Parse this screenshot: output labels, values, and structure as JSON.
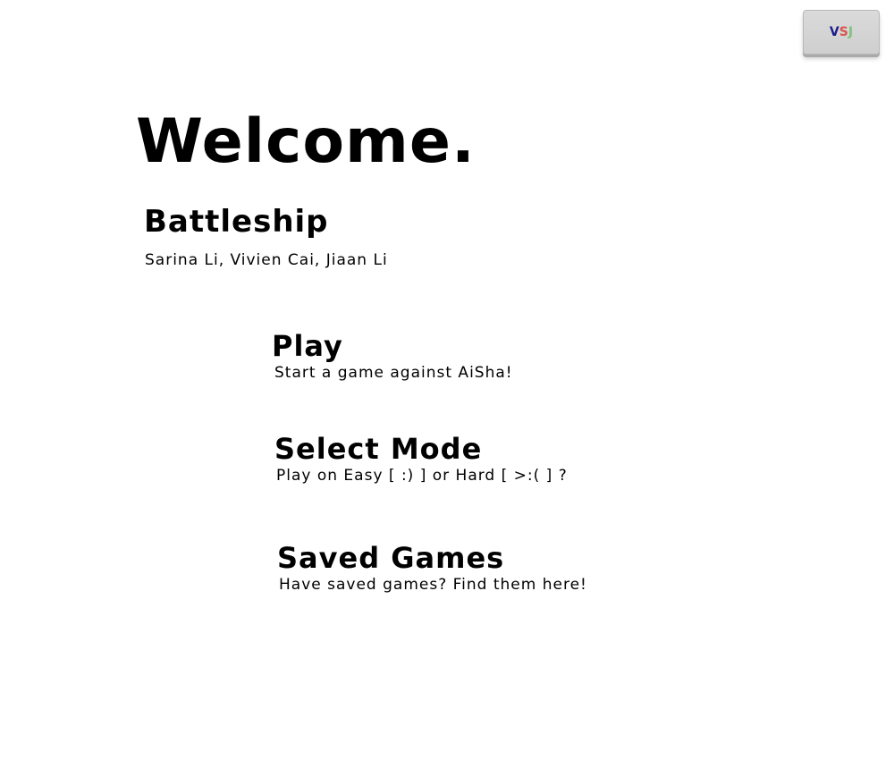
{
  "header": {
    "welcome": "Welcome.",
    "title": "Battleship",
    "authors": "Sarina Li, Vivien Cai, Jiaan Li"
  },
  "corner_button": {
    "letters": [
      {
        "char": "V",
        "color": "#1a1a8c"
      },
      {
        "char": "S",
        "color": "#d9534f"
      },
      {
        "char": "J",
        "color": "#7cc47c"
      }
    ]
  },
  "menu": {
    "play": {
      "title": "Play",
      "description": "Start a game against AiSha!"
    },
    "select_mode": {
      "title": "Select Mode",
      "description": "Play on Easy [ :) ] or Hard [ >:( ] ?"
    },
    "saved_games": {
      "title": "Saved Games",
      "description": "Have saved games? Find them here!"
    }
  }
}
